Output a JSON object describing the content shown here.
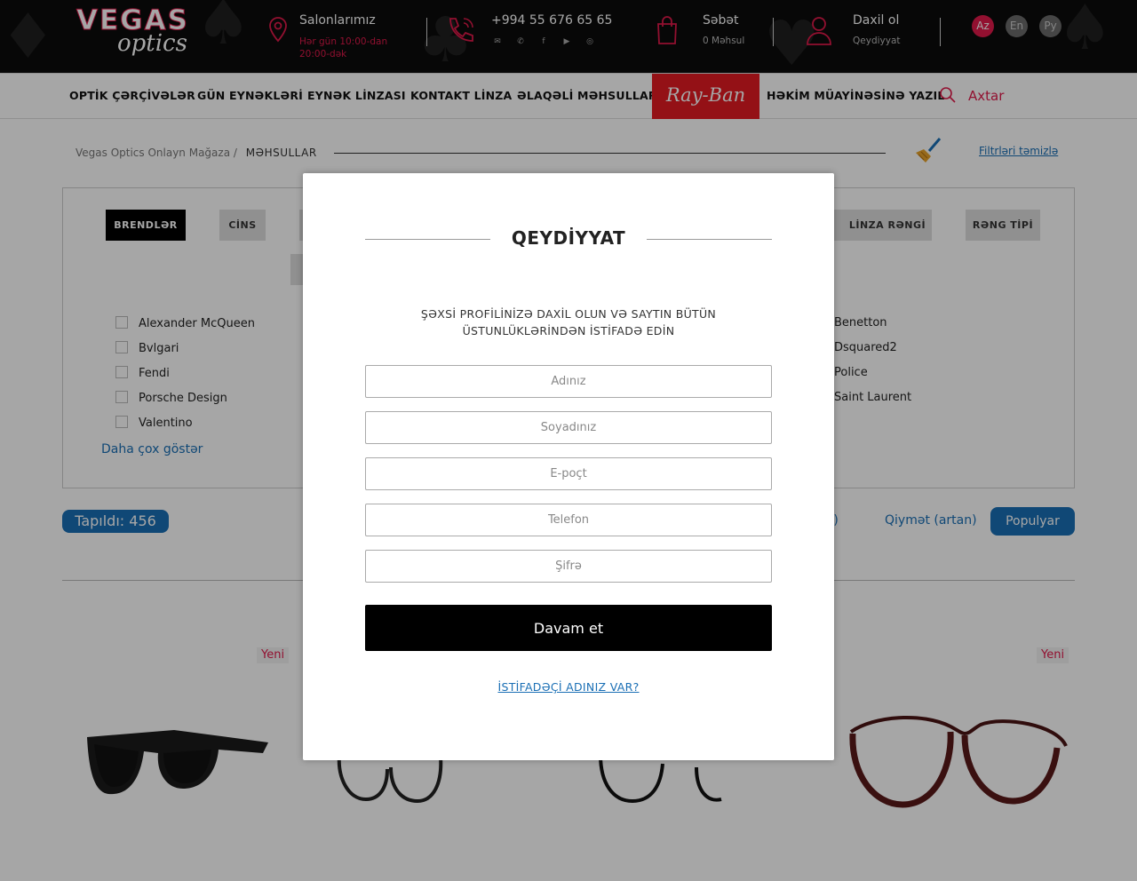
{
  "header": {
    "logo_top": "VEGAS",
    "logo_bottom": "optics",
    "salons": {
      "title": "Salonlarımız",
      "hours": "Hər gün 10:00-dan 20:00-dək"
    },
    "phone": {
      "number": "+994 55 676 65 65"
    },
    "cart": {
      "title": "Səbət",
      "count": "0 Məhsul"
    },
    "account": {
      "title": "Daxil ol",
      "sub": "Qeydiyyat"
    },
    "languages": [
      "Az",
      "En",
      "Ру"
    ],
    "accent": "#e0194a"
  },
  "nav": {
    "items": [
      "OPTİK ÇƏRÇİVƏLƏR",
      "GÜN EYNƏKLƏRİ",
      "EYNƏK LİNZASI",
      "KONTAKT LİNZA",
      "ƏLAQƏLİ MƏHSULLAR"
    ],
    "brand_label": "Ray-Ban",
    "appointment": "HƏKİM MÜAYİNƏSİNƏ YAZIL",
    "search_label": "Axtar"
  },
  "breadcrumb": {
    "home": "Vegas Optics Onlayn Mağaza",
    "sep": "/",
    "current": "MƏHSULLAR"
  },
  "filters": {
    "clear_label": "Filtrləri təmizlə",
    "tabs": [
      "BRENDLƏR",
      "CİNS",
      "LİNZA RƏNGİ",
      "RƏNG TİPİ"
    ],
    "brands_left": [
      "Alexander McQueen",
      "Bvlgari",
      "Fendi",
      "Porsche Design",
      "Valentino"
    ],
    "brands_right": [
      "Benetton",
      "Dsquared2",
      "Police",
      "Saint Laurent"
    ],
    "more_label": "Daha çox göstər"
  },
  "results": {
    "found_label": "Tapıldı: 456",
    "sort_partial": "lan)",
    "sort_price_asc": "Qiymət (artan)",
    "sort_popular": "Populyar"
  },
  "products": {
    "new_badge": "Yeni"
  },
  "modal": {
    "title": "QEYDİYYAT",
    "subtitle": "ŞƏXSİ PROFİLİNİZƏ DAXİL OLUN VƏ SAYTIN BÜTÜN ÜSTUNLÜKLƏRİNDƏN İSTİFADƏ EDİN",
    "fields": {
      "name": "Adınız",
      "surname": "Soyadınız",
      "email": "E-poçt",
      "phone": "Telefon",
      "password": "Şifrə"
    },
    "submit": "Davam et",
    "login_link": "İSTİFADƏÇİ ADINIZ VAR?"
  }
}
